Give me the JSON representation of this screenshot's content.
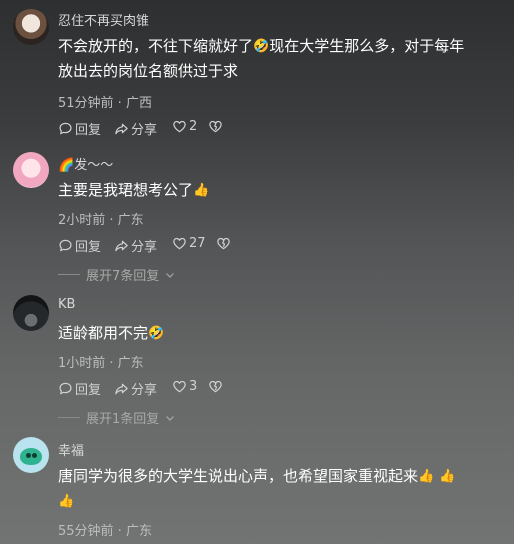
{
  "comments": [
    {
      "username": "忍住不再买肉锥",
      "line1": "不会放开的，不往下缩就好了",
      "line1_tail": "现在大学生那么多，对于每年",
      "line2": "放出去的岗位名额供过于求",
      "emoji": "🤣",
      "meta": "51分钟前 · 广西",
      "reply_label": "回复",
      "share_label": "分享",
      "like_count": "2"
    },
    {
      "username": "发～～",
      "username_prefix_emoji": "🌈",
      "line1": "主要是我珺想考公了",
      "emoji": "👍",
      "meta": "2小时前 · 广东",
      "reply_label": "回复",
      "share_label": "分享",
      "like_count": "27",
      "expand_label": "展开7条回复"
    },
    {
      "username": "KB",
      "line1": "适龄都用不完",
      "emoji": "🤣",
      "meta": "1小时前 · 广东",
      "reply_label": "回复",
      "share_label": "分享",
      "like_count": "3",
      "expand_label": "展开1条回复"
    },
    {
      "username": "幸福",
      "line1": "唐同学为很多的大学生说出心声，也希望国家重视起来",
      "emoji": "👍",
      "meta": "55分钟前 · 广东"
    }
  ]
}
